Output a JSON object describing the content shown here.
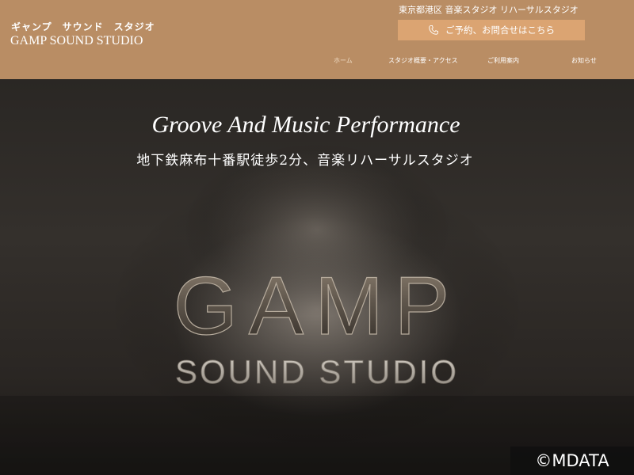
{
  "header": {
    "logo_kana": "ギャンプ　サウンド　スタジオ",
    "logo_name": "GAMP SOUND STUDIO",
    "tagline": "東京都港区 音楽スタジオ リハーサルスタジオ",
    "contact_button": {
      "icon": "phone-icon",
      "label": "ご予約、お問合せはこちら"
    },
    "nav": [
      {
        "label": "ホーム",
        "active": true
      },
      {
        "label": "スタジオ概要・アクセス",
        "active": false
      },
      {
        "label": "ご利用案内",
        "active": false
      },
      {
        "label": "お知らせ",
        "active": false
      }
    ]
  },
  "hero": {
    "title": "Groove And Music Performance",
    "subtitle": "地下鉄麻布十番駅徒歩2分、音楽リハーサルスタジオ",
    "sign_main": "GAMP",
    "sign_sub": "SOUND STUDIO"
  },
  "watermark": "©MDATA",
  "colors": {
    "header_bg": "#b98d64",
    "button_bg": "#dba472",
    "text": "#ffffff",
    "hero_bg": "#2e2a27"
  }
}
